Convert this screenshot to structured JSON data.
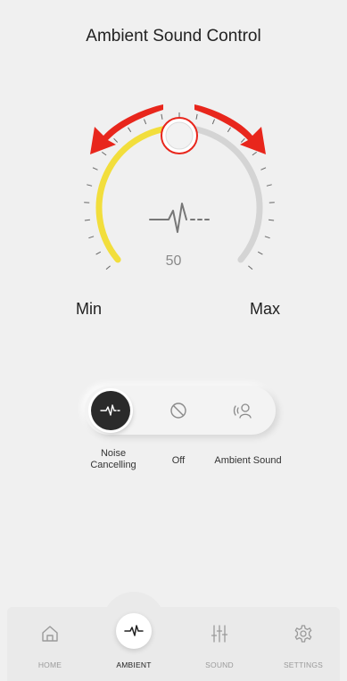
{
  "header": {
    "title": "Ambient Sound Control"
  },
  "dial": {
    "value": "50",
    "level_fraction": 0.5,
    "min_label": "Min",
    "max_label": "Max",
    "active_color": "#f2de3c",
    "inactive_color": "#d4d4d4",
    "arrow_color": "#e8261c",
    "center_icon": "waveform-icon"
  },
  "modes": {
    "selected": "noise_cancelling",
    "items": [
      {
        "id": "noise_cancelling",
        "label": "Noise\nCancelling",
        "icon": "waveform-icon"
      },
      {
        "id": "off",
        "label": "Off",
        "icon": "prohibited-icon"
      },
      {
        "id": "ambient_sound",
        "label": "Ambient Sound",
        "icon": "person-sound-icon"
      }
    ]
  },
  "nav": {
    "items": [
      {
        "label": "HOME",
        "icon": "home-icon"
      },
      {
        "label": "AMBIENT",
        "icon": "waveform-icon"
      },
      {
        "label": "SOUND",
        "icon": "equalizer-icon"
      },
      {
        "label": "SETTINGS",
        "icon": "gear-icon"
      }
    ],
    "active_index": 1
  }
}
